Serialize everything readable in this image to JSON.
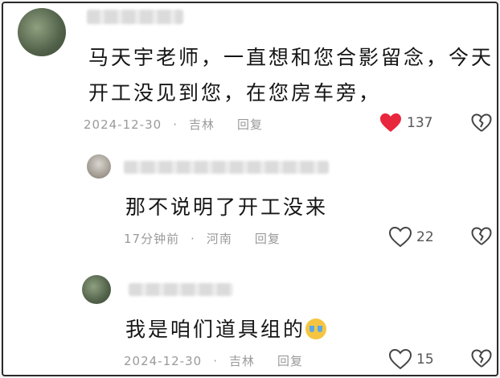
{
  "comments": [
    {
      "text_line1": "马天宇老师，一直想和您合影留念，今天",
      "text_line2": "开工没见到您，在您房车旁，",
      "date": "2024-12-30",
      "location": "吉林",
      "reply_label": "回复",
      "likes": "137",
      "liked": true,
      "username_blur_partial": "图"
    },
    {
      "text_line1": "那不说明了开工没来",
      "date": "17分钟前",
      "location": "河南",
      "reply_label": "回复",
      "likes": "22",
      "liked": false
    },
    {
      "text_line1": "我是咱们道具组的",
      "date": "2024-12-30",
      "location": "吉林",
      "reply_label": "回复",
      "likes": "15",
      "liked": false
    }
  ],
  "colors": {
    "heart_active": "#e8273d",
    "meta_text": "#9a9a9a",
    "body_text": "#151515"
  }
}
